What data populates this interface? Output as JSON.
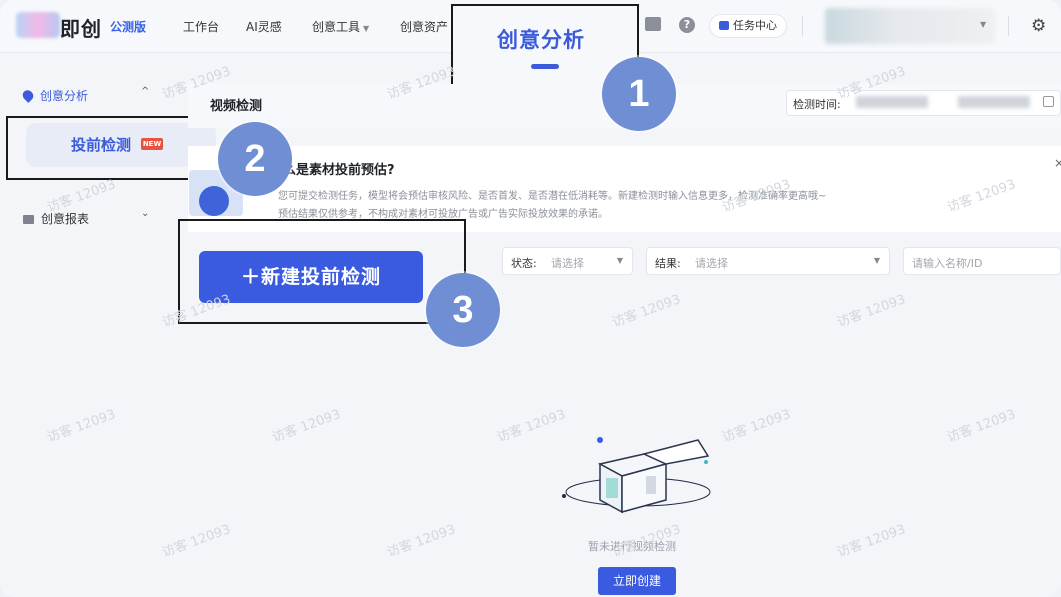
{
  "header": {
    "logo_text": "即创",
    "beta_label": "公测版",
    "nav": [
      {
        "label": "工作台",
        "caret": ""
      },
      {
        "label": "AI灵感",
        "caret": ""
      },
      {
        "label": "创意工具",
        "caret": "▼"
      },
      {
        "label": "创意资产",
        "caret": ""
      }
    ],
    "active_nav": "创意分析",
    "help_glyph": "?",
    "task_center": "任务中心",
    "settings_glyph": "⚙"
  },
  "sidebar": {
    "group1": {
      "label": "创意分析",
      "caret": "^"
    },
    "active_item": {
      "label": "投前检测",
      "tag": "NEW"
    },
    "group2": {
      "label": "创意报表",
      "caret": "⌄"
    }
  },
  "main": {
    "title": "视频检测",
    "date_label": "检测时间:",
    "info": {
      "title": "么是素材投前预估?",
      "line1": "您可提交检测任务，模型将会预估审核风险、是否首发、是否潜在低消耗等。新建检测时输入信息更多，检测准确率更高哦~",
      "line2": "预估结果仅供参考，不构成对素材可投放广告或广告实际投放效果的承诺。",
      "close": "×"
    },
    "create_button": "＋新建投前检测",
    "filters": {
      "status_label": "状态:",
      "status_placeholder": "请选择",
      "result_label": "结果:",
      "result_placeholder": "请选择",
      "search_placeholder": "请输入名称/ID"
    },
    "empty": {
      "text": "暂未进行视频检测",
      "button": "立即创建"
    }
  },
  "badges": [
    "1",
    "2",
    "3"
  ],
  "watermark": "访客 12093",
  "colors": {
    "accent": "#3b5bdb",
    "badge": "#6f8ed3",
    "new_tag": "#e8523f"
  }
}
